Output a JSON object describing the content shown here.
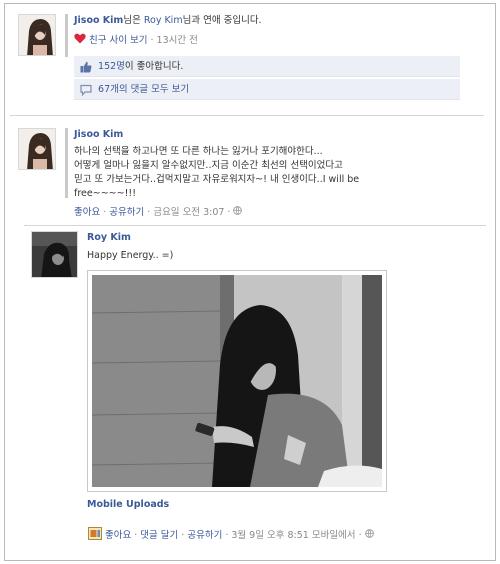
{
  "post1": {
    "author": "Jisoo Kim",
    "text_mid": "님은 ",
    "partner": "Roy Kim",
    "text_end": "님과 연애 중입니다.",
    "friendship_link": "친구 사이 보기",
    "time": " · 13시간 전",
    "likes_count": "152명",
    "likes_suffix": "이 좋아합니다.",
    "comments_link": "67개의 댓글 모두 보기"
  },
  "post2": {
    "author": "Jisoo Kim",
    "lines": [
      "하나의 선택을 하고나면 또 다른 하나는 잃거나 포기해야한다...",
      "어떻게 얼마나 잃을지 알수없지만..지금 이순간 최선의 선택이었다고",
      "믿고 또 가보는거다..겁먹지말고 자유로워지자~! 내 인생이다..I will be",
      "free~~~~!!!"
    ],
    "like": "좋아요",
    "share": "공유하기",
    "time": "금요일 오전 3:07"
  },
  "post3": {
    "author": "Roy Kim",
    "text": "Happy Energy.. =)",
    "album": "Mobile Uploads",
    "like": "좋아요",
    "comment": "댓글 달기",
    "share": "공유하기",
    "time": "3월 9일 오후 8:51 모바일에서"
  },
  "colors": {
    "link": "#3b5998",
    "heart": "#d8293b",
    "box": "#eceff5"
  },
  "icons": [
    "heart-icon",
    "thumbs-up-icon",
    "comment-icon",
    "globe-icon",
    "mobile-upload-icon"
  ]
}
